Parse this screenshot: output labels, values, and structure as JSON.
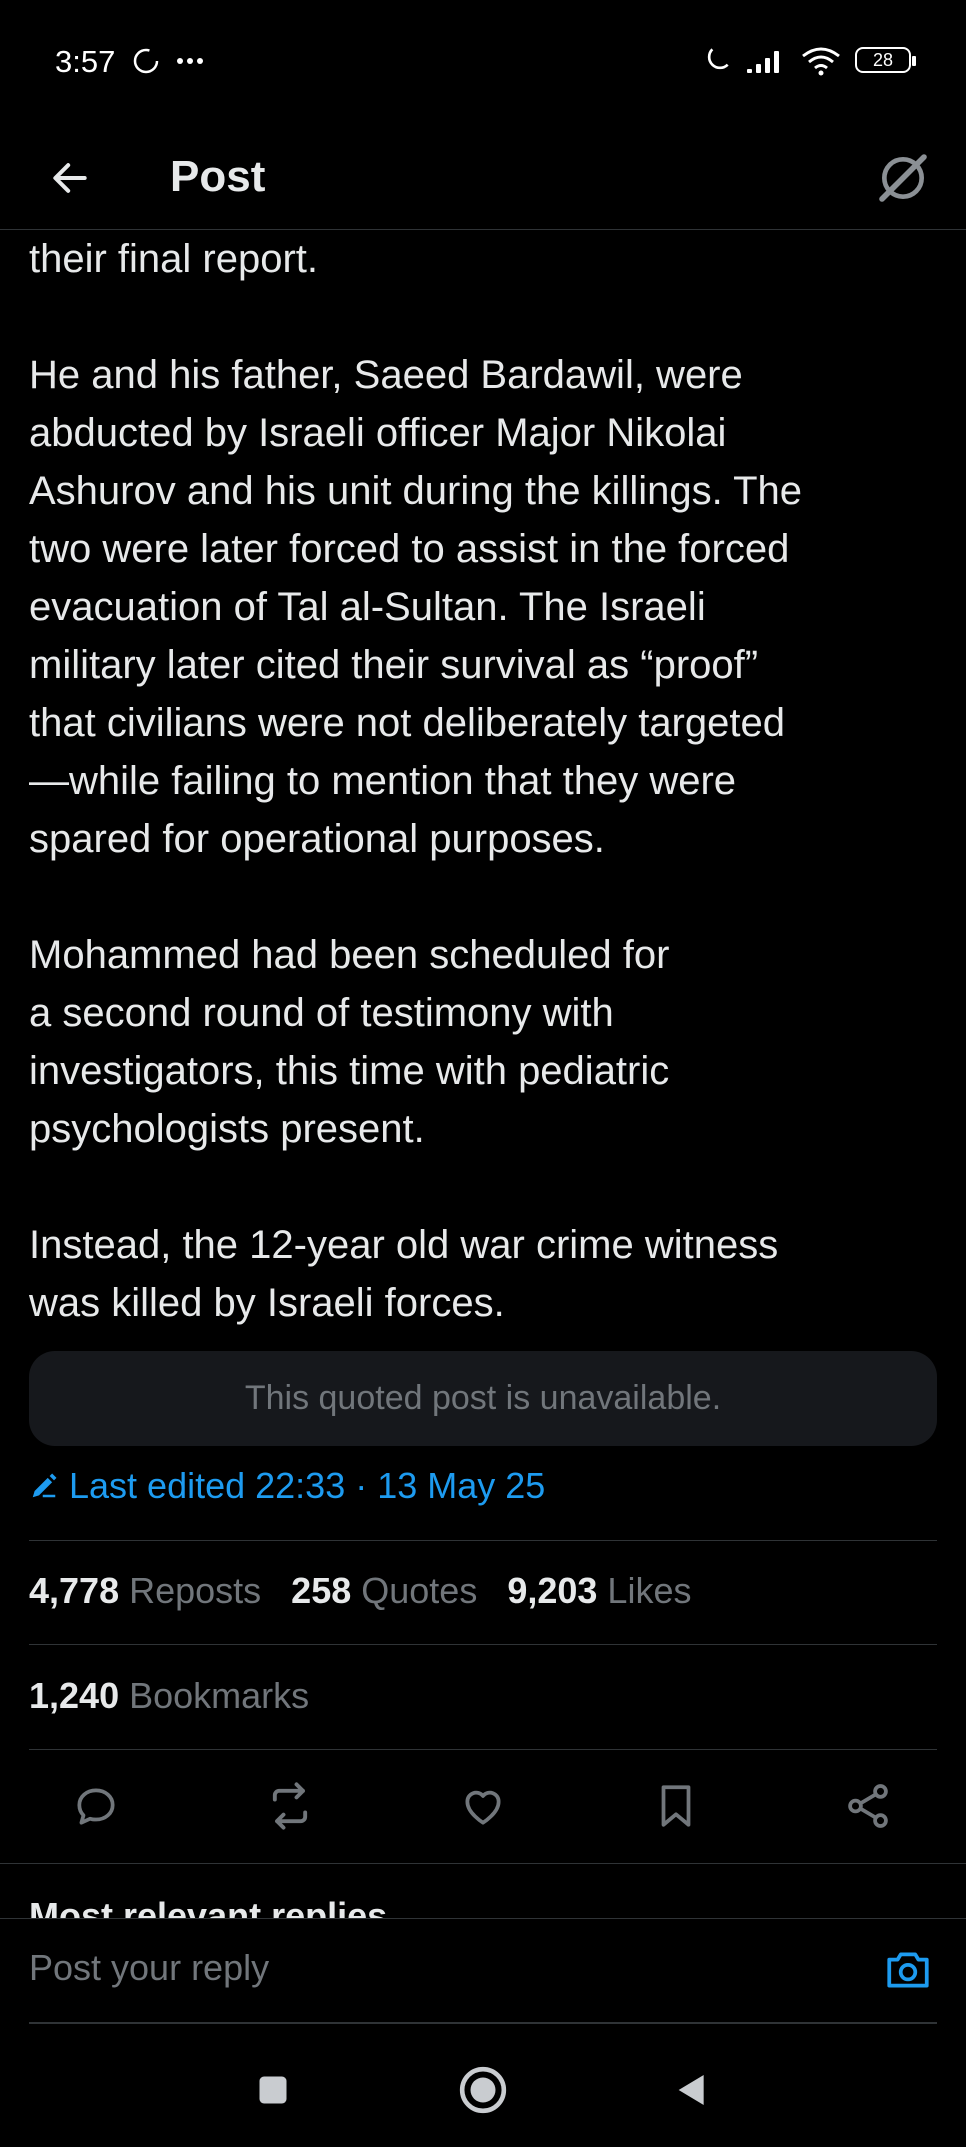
{
  "status_bar": {
    "time": "3:57",
    "battery": "28",
    "icons": [
      "sync-icon",
      "more-icon",
      "moon-icon",
      "signal-icon",
      "wifi-icon",
      "battery-icon"
    ]
  },
  "header": {
    "title": "Post",
    "back_icon": "arrow-left-icon",
    "grok_icon": "grok-icon"
  },
  "post": {
    "paragraphs": [
      "their final report.",
      "He and his father, Saeed Bardawil, were\nabducted by Israeli officer Major Nikolai\nAshurov and his unit during the killings. The\ntwo were later forced to assist in the forced\nevacuation of Tal al-Sultan. The Israeli\nmilitary later cited their survival as “proof”\nthat civilians were not deliberately targeted\n—while failing to mention that they were\nspared for operational purposes.",
      "Mohammed had been scheduled for\na second round of testimony with\ninvestigators, this time with pediatric\npsychologists present.",
      "Instead, the 12-year old war crime witness\nwas killed by Israeli forces."
    ],
    "quoted_unavailable": "This quoted post is unavailable.",
    "last_edited": "Last edited 22:33 · 13 May 25"
  },
  "stats": {
    "reposts": {
      "count": "4,778",
      "label": "Reposts"
    },
    "quotes": {
      "count": "258",
      "label": "Quotes"
    },
    "likes": {
      "count": "9,203",
      "label": "Likes"
    },
    "bookmarks": {
      "count": "1,240",
      "label": "Bookmarks"
    }
  },
  "actions": [
    "reply-icon",
    "repost-icon",
    "like-icon",
    "bookmark-icon",
    "share-icon"
  ],
  "replies_header": "Most relevant replies",
  "reply_bar": {
    "placeholder": "Post your reply"
  },
  "colors": {
    "background": "#000000",
    "text": "#e7e9ea",
    "muted": "#71767b",
    "accent": "#1d9bf0",
    "divider": "#2f3336"
  }
}
